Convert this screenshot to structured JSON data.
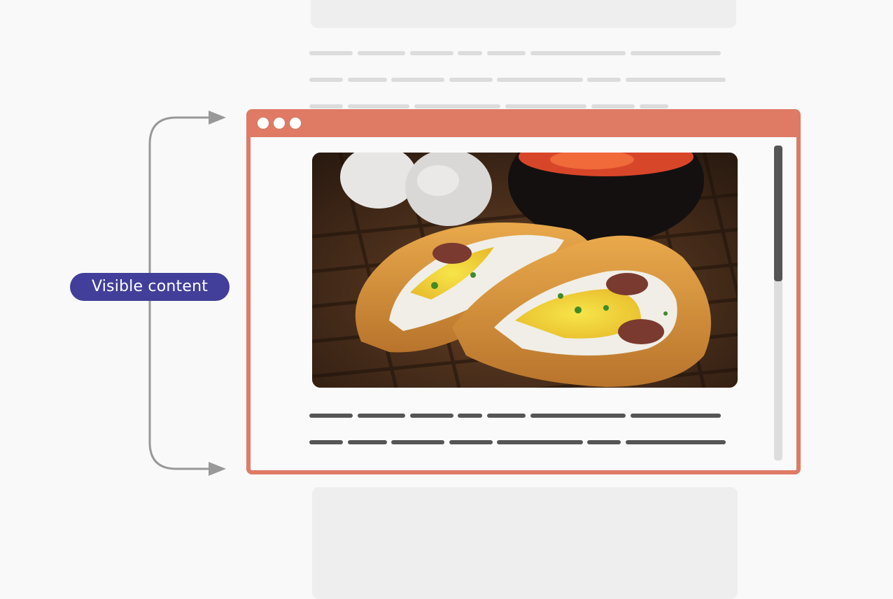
{
  "annotation": {
    "label": "Visible content",
    "label_bg": "#423f9a",
    "arrow_color": "#999999"
  },
  "browser_window": {
    "frame_color": "#df7a65",
    "titlebar_buttons": [
      "window-dot-icon",
      "window-dot-icon",
      "window-dot-icon"
    ],
    "image_subject": "egg-and-sausage-pastry-photo",
    "scrollbar": {
      "thumb_color": "#555555",
      "track_color": "#dddddd",
      "scroll_fraction": 0.0
    }
  },
  "colors": {
    "background": "#f9f9f9",
    "placeholder_block": "#eeeeee",
    "placeholder_line_faint": "#dcdcdc",
    "placeholder_line_dark": "#555555"
  }
}
